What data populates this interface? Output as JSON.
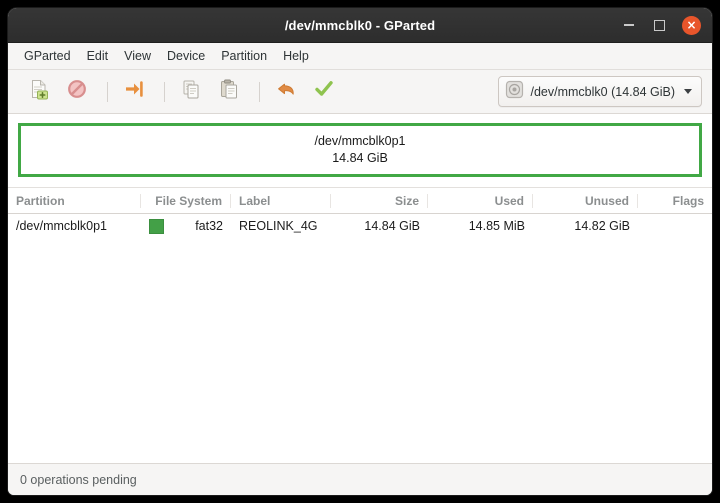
{
  "window": {
    "title": "/dev/mmcblk0 - GParted",
    "controls": {
      "minimize": "minimize-icon",
      "maximize": "maximize-icon",
      "close": "×"
    }
  },
  "menubar": {
    "items": [
      {
        "label": "GParted"
      },
      {
        "label": "Edit"
      },
      {
        "label": "View"
      },
      {
        "label": "Device"
      },
      {
        "label": "Partition"
      },
      {
        "label": "Help"
      }
    ]
  },
  "toolbar": {
    "buttons": [
      {
        "name": "new-partition-icon",
        "tooltip": "New"
      },
      {
        "name": "delete-partition-icon",
        "tooltip": "Delete"
      },
      {
        "name": "resize-move-icon",
        "tooltip": "Resize/Move"
      },
      {
        "name": "copy-icon",
        "tooltip": "Copy"
      },
      {
        "name": "paste-icon",
        "tooltip": "Paste"
      },
      {
        "name": "undo-icon",
        "tooltip": "Undo"
      },
      {
        "name": "apply-icon",
        "tooltip": "Apply All Operations"
      }
    ],
    "device_selector": {
      "icon": "harddisk-icon",
      "value": "/dev/mmcblk0 (14.84 GiB)"
    }
  },
  "graphic": {
    "partition_name": "/dev/mmcblk0p1",
    "partition_size": "14.84 GiB",
    "border_color": "#41a845",
    "fill_color": "#ffffff"
  },
  "table": {
    "headers": [
      "Partition",
      "File System",
      "Label",
      "Size",
      "Used",
      "Unused",
      "Flags"
    ],
    "rows": [
      {
        "partition": "/dev/mmcblk0p1",
        "filesystem": "fat32",
        "filesystem_color": "#43a047",
        "label": "REOLINK_4G",
        "size": "14.84 GiB",
        "used": "14.85 MiB",
        "unused": "14.82 GiB",
        "flags": ""
      }
    ]
  },
  "statusbar": {
    "text": "0 operations pending"
  }
}
